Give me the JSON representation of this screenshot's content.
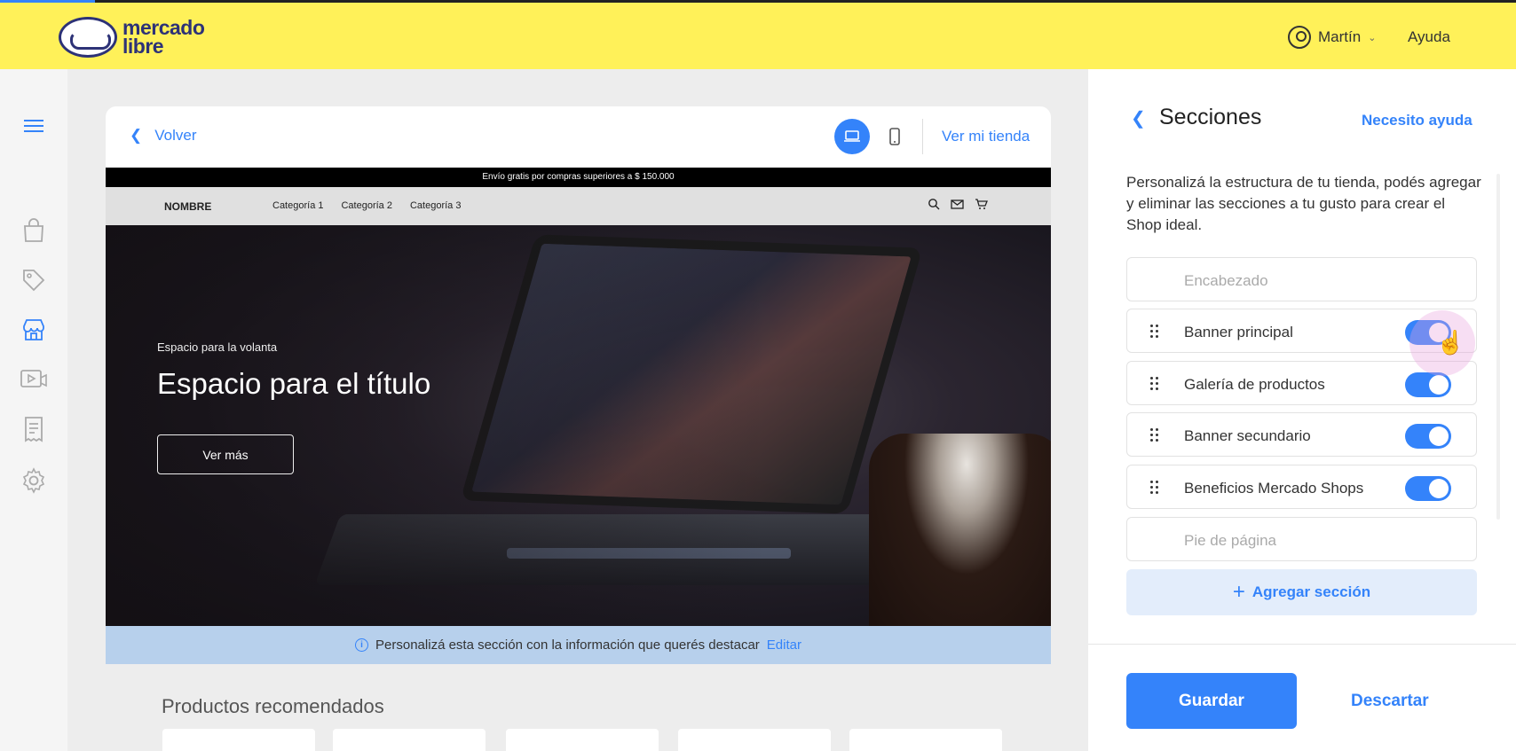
{
  "topbar": {
    "brand_line1": "mercado",
    "brand_line2": "libre",
    "user_name": "Martín",
    "help_label": "Ayuda"
  },
  "rail": {
    "icons": [
      "menu-icon",
      "bag-icon",
      "tag-icon",
      "store-icon",
      "video-icon",
      "receipt-icon",
      "gear-icon"
    ],
    "active": "store-icon"
  },
  "preview": {
    "back_label": "Volver",
    "view_store_label": "Ver mi tienda",
    "device_selected": "desktop",
    "promo_text": "Envío gratis por compras superiores a $ 150.000",
    "shop_name": "NOMBRE",
    "categories": [
      "Categoría 1",
      "Categoría 2",
      "Categoría 3"
    ],
    "hero": {
      "volanta": "Espacio para la volanta",
      "title": "Espacio para el título",
      "button": "Ver más"
    },
    "info_text": "Personalizá esta sección con la información que querés destacar",
    "info_link": "Editar",
    "recommended_title": "Productos recomendados"
  },
  "panel": {
    "title": "Secciones",
    "help_link": "Necesito ayuda",
    "description": "Personalizá la estructura de tu tienda, podés agregar y eliminar las secciones a tu gusto para crear el Shop ideal.",
    "sections": [
      {
        "label": "Encabezado",
        "fixed": true
      },
      {
        "label": "Banner principal",
        "enabled": true
      },
      {
        "label": "Galería de productos",
        "enabled": true
      },
      {
        "label": "Banner secundario",
        "enabled": true
      },
      {
        "label": "Beneficios Mercado Shops",
        "enabled": true
      },
      {
        "label": "Pie de página",
        "fixed": true
      }
    ],
    "add_section_label": "Agregar sección",
    "save_label": "Guardar",
    "discard_label": "Descartar"
  },
  "colors": {
    "brand_yellow": "#fff159",
    "accent_blue": "#3483fa",
    "info_bar": "#b7d0ec"
  }
}
